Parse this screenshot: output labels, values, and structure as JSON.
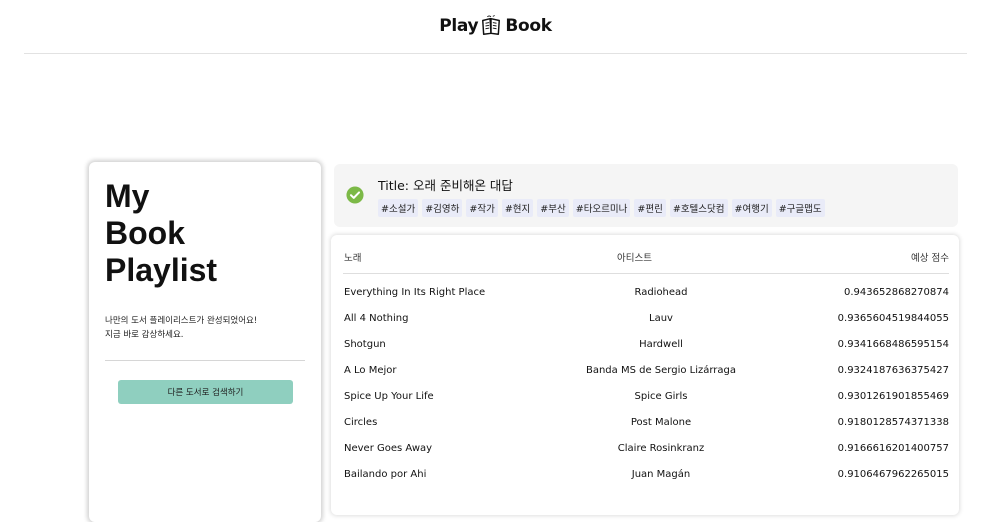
{
  "header": {
    "logo_left": "Play",
    "logo_right": "Book",
    "logo_icon": "book-icon"
  },
  "sidebar": {
    "title": "My\nBook\nPlaylist",
    "description": "나만의 도서 플레이리스트가 완성되었어요!\n지금 바로 감상하세요.",
    "search_button_label": "다른 도서로 검색하기"
  },
  "info": {
    "status_icon": "check-circle-icon",
    "status_color": "#7cb947",
    "title": "Title: 오래 준비해온 대답",
    "tags": [
      "#소설가",
      "#김영하",
      "#작가",
      "#현지",
      "#부산",
      "#타오르미나",
      "#편린",
      "#호텔스닷컴",
      "#여행기",
      "#구글맵도"
    ]
  },
  "table": {
    "columns": [
      "노래",
      "아티스트",
      "예상 점수"
    ],
    "rows": [
      {
        "song": "Everything In Its Right Place",
        "artist": "Radiohead",
        "score": "0.943652868270874"
      },
      {
        "song": "All 4 Nothing",
        "artist": "Lauv",
        "score": "0.9365604519844055"
      },
      {
        "song": "Shotgun",
        "artist": "Hardwell",
        "score": "0.9341668486595154"
      },
      {
        "song": "A Lo Mejor",
        "artist": "Banda MS de Sergio Lizárraga",
        "score": "0.9324187636375427"
      },
      {
        "song": "Spice Up Your Life",
        "artist": "Spice Girls",
        "score": "0.9301261901855469"
      },
      {
        "song": "Circles",
        "artist": "Post Malone",
        "score": "0.9180128574371338"
      },
      {
        "song": "Never Goes Away",
        "artist": "Claire Rosinkranz",
        "score": "0.9166616201400757"
      },
      {
        "song": "Bailando por Ahi",
        "artist": "Juan Magán",
        "score": "0.9106467962265015"
      }
    ]
  },
  "colors": {
    "accent_button": "#8fcfbf",
    "tag_background": "#e9ebf8",
    "info_background": "#f5f5f5"
  }
}
